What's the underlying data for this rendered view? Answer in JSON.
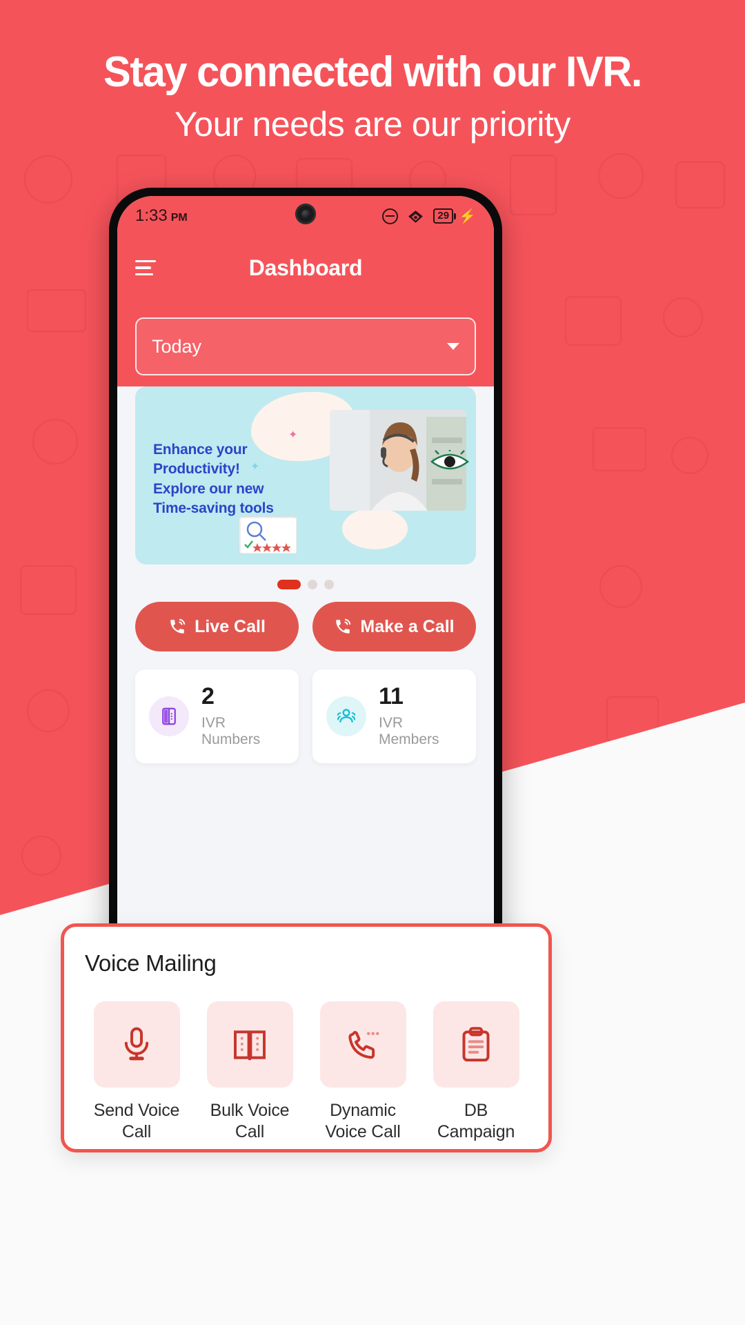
{
  "promo": {
    "headline": "Stay connected with our IVR.",
    "subheadline": "Your needs are our priority",
    "background_color": "#F5535A"
  },
  "phone": {
    "status_bar": {
      "time": "1:33",
      "ampm": "PM",
      "dnd_icon": "do-not-disturb-icon",
      "wifi_icon": "wifi-icon",
      "battery_level": "29",
      "charging_icon": "lightning-bolt-icon"
    },
    "app_bar": {
      "menu_icon": "hamburger-menu-icon",
      "title": "Dashboard"
    },
    "filter": {
      "selected": "Today",
      "caret_icon": "chevron-down-icon"
    },
    "banner": {
      "line1": "Enhance your",
      "line2": "Productivity!",
      "line3": "Explore our new",
      "line4": "Time-saving tools",
      "text_color": "#2A45C8",
      "background_color": "#BFEAF0"
    },
    "carousel": {
      "total_dots": 3,
      "active_index": 0
    },
    "actions": [
      {
        "label": "Live Call",
        "icon": "phone-ring-icon"
      },
      {
        "label": "Make a Call",
        "icon": "phone-ring-icon"
      }
    ],
    "stats": [
      {
        "value": "2",
        "label": "IVR Numbers",
        "icon": "address-book-icon",
        "accent": "#8B3FE0"
      },
      {
        "value": "11",
        "label": "IVR Members",
        "icon": "user-group-icon",
        "accent": "#16BDD4"
      }
    ]
  },
  "voice_mailing": {
    "title": "Voice Mailing",
    "accent_color": "#F0564F",
    "items": [
      {
        "label": "Send Voice Call",
        "icon": "microphone-icon"
      },
      {
        "label": "Bulk Voice Call",
        "icon": "open-book-icon"
      },
      {
        "label": "Dynamic Voice Call",
        "icon": "phone-dots-icon"
      },
      {
        "label": "DB Campaign",
        "icon": "clipboard-icon"
      }
    ]
  }
}
